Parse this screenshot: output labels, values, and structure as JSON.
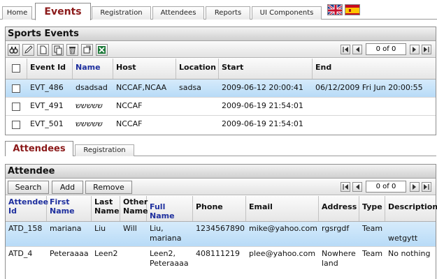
{
  "top_tabs": [
    "Home",
    "Events",
    "Registration",
    "Attendees",
    "Reports",
    "UI Components"
  ],
  "events_panel": {
    "title": "Sports Events",
    "pager": "0 of 0",
    "columns": [
      "Event Id",
      "Name",
      "Host",
      "Location",
      "Start",
      "End"
    ],
    "rows": [
      {
        "event_id": "EVT_486",
        "name": "dsadsad",
        "host": "NCCAF,NCAA",
        "location": "sadsa",
        "start": "2009-06-12 20:00:41",
        "end": "06/12/2009 Fri Jun 20:00:55"
      },
      {
        "event_id": "EVT_491",
        "name": "ששששש",
        "host": "NCCAF",
        "location": "",
        "start": "2009-06-19 21:54:01",
        "end": ""
      },
      {
        "event_id": "EVT_501",
        "name": "ששששש",
        "host": "NCCAF",
        "location": "",
        "start": "2009-06-19 21:54:01",
        "end": ""
      }
    ]
  },
  "sub_tabs": [
    "Attendees",
    "Registration"
  ],
  "attendee_panel": {
    "title": "Attendee",
    "buttons": {
      "search": "Search",
      "add": "Add",
      "remove": "Remove"
    },
    "pager": "0 of 0",
    "columns": [
      "Attendee Id",
      "First Name",
      "Last Name",
      "Other Name",
      "Full Name",
      "Phone",
      "Email",
      "Address",
      "Type",
      "Description"
    ],
    "rows": [
      {
        "id": "ATD_158",
        "first": "mariana",
        "last": "Liu",
        "other": "Will",
        "full": "Liu, mariana",
        "phone": "1234567890",
        "email": "mike@yahoo.com",
        "address": "rgsrgdf",
        "type": "Team",
        "description": "wetgytt"
      },
      {
        "id": "ATD_4",
        "first": "Peteraaaa",
        "last": "Leen2",
        "other": "",
        "full": "Leen2, Peteraaaa",
        "phone": "408111219",
        "email": "plee@yahoo.com",
        "address": "Nowhere land",
        "type": "Team",
        "description": "No nothing"
      }
    ]
  },
  "colors": {
    "active_tab": "#8b1a1a",
    "sortable_header": "#1e2f9e",
    "selected_row": "#b8dbf7"
  },
  "icons": [
    "find-icon",
    "edit-icon",
    "new-icon",
    "copy-icon",
    "delete-icon",
    "refresh-icon",
    "excel-export-icon",
    "uk-flag-icon",
    "spain-flag-icon"
  ]
}
